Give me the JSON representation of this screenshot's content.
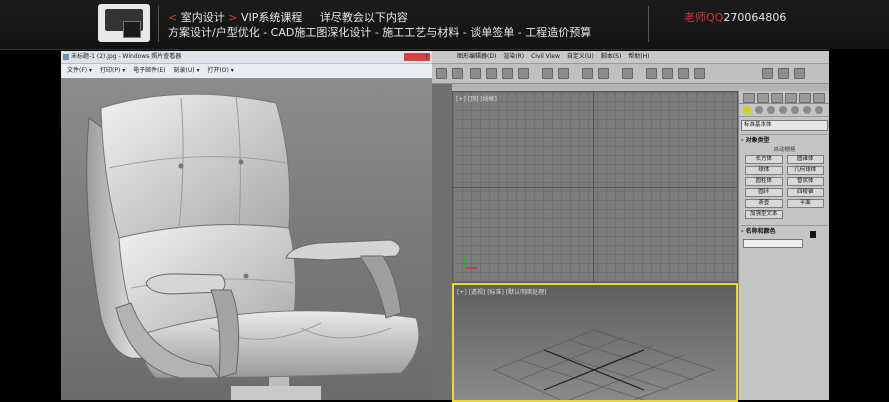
{
  "banner": {
    "line1_prefix": "<",
    "line1_item1": "室内设计",
    "line1_gt": ">",
    "line1_item2": "VIP系统课程",
    "line1_item3": "详尽教会以下内容",
    "line2": "方案设计/户型优化 - CAD施工图深化设计 - 施工工艺与材料 - 谈单签单 - 工程造价预算",
    "teacher_label": "老师QQ",
    "teacher_number": "270064806",
    "colors": {
      "accent": "#c93b36",
      "text": "#e8e8e8",
      "background": "#141414"
    }
  },
  "viewer": {
    "title": "未标题-1 (2).jpg - Windows 照片查看器",
    "menu": [
      "文件(F) ▾",
      "打印(P) ▾",
      "电子邮件(E)",
      "刻录(U) ▾",
      "打开(O) ▾"
    ],
    "help": "?"
  },
  "max": {
    "menu": [
      "",
      "图形编辑器(D)",
      "渲染(R)",
      "Civil View",
      "自定义(U)",
      "脚本(S)",
      "帮助(H)"
    ],
    "viewport_top_label": "[+] [顶] [线框]",
    "viewport_persp_label": "[+] [透视] [标准] [默认明暗处理]",
    "panel": {
      "dropdown": "标准基本体",
      "rollout_object_type": "对象类型",
      "autogrid": "自动栅格",
      "buttons": [
        "长方体",
        "圆锥体",
        "球体",
        "几何球体",
        "圆柱体",
        "管状体",
        "圆环",
        "四棱锥",
        "茶壶",
        "平面",
        "加强型文本"
      ],
      "rollout_name_color": "名称和颜色"
    }
  }
}
